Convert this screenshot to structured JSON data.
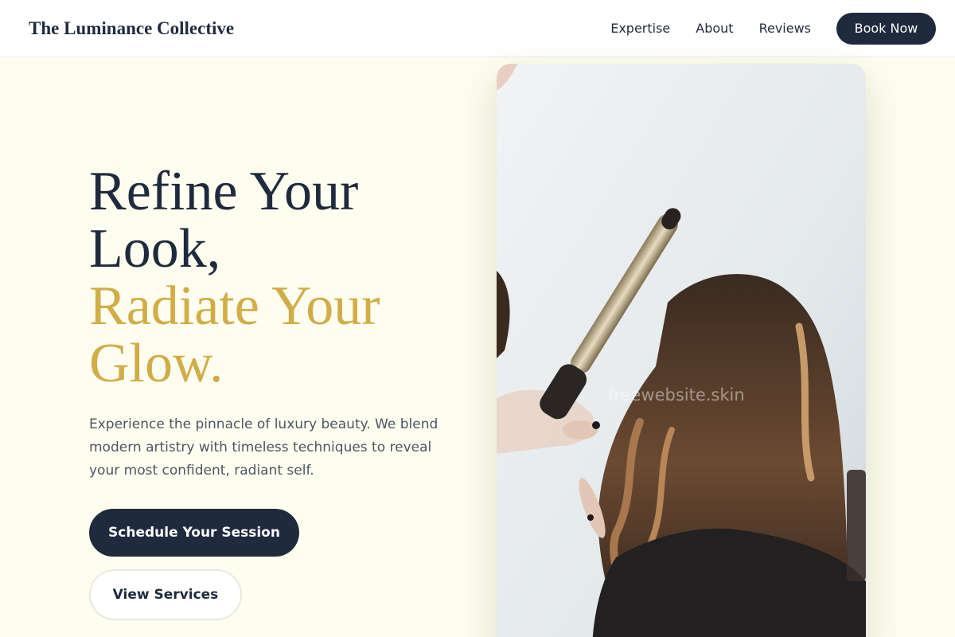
{
  "header": {
    "brand": "The Luminance Collective",
    "nav": [
      "Expertise",
      "About",
      "Reviews"
    ],
    "cta": "Book Now"
  },
  "hero": {
    "title_line1": "Refine Your",
    "title_line2": "Look,",
    "title_accent_line1": "Radiate Your",
    "title_accent_line2": "Glow.",
    "description": "Experience the pinnacle of luxury beauty. We blend modern artistry with timeless techniques to reveal your most confident, radiant self.",
    "primary_button": "Schedule Your Session",
    "secondary_button": "View Services",
    "image_watermark": "freewebsite.skin"
  },
  "colors": {
    "navy": "#1f2a3d",
    "gold": "#d1ad47",
    "background": "#fefef0"
  }
}
